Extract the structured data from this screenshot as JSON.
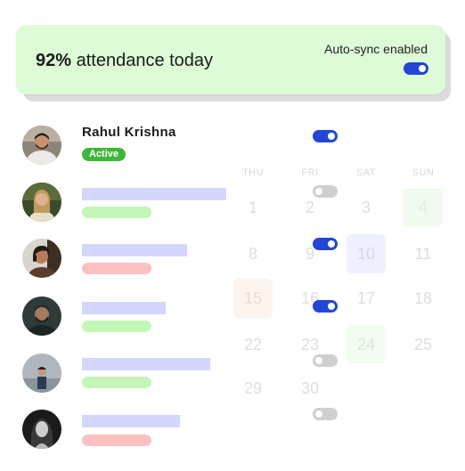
{
  "banner": {
    "percent": "92%",
    "title_rest": " attendance today",
    "sync_label": "Auto-sync enabled",
    "sync_on": true
  },
  "calendar": {
    "weekdays": [
      "THU",
      "FRI",
      "SAT",
      "SUN"
    ],
    "rows": [
      [
        "1",
        "2",
        "3",
        "4"
      ],
      [
        "8",
        "9",
        "10",
        "11"
      ],
      [
        "15",
        "16",
        "17",
        "18"
      ],
      [
        "22",
        "23",
        "24",
        "25"
      ],
      [
        "29",
        "30",
        "",
        ""
      ]
    ]
  },
  "students": [
    {
      "name": "Rahul Krishna",
      "status": "Active",
      "status_color": "green",
      "toggle_on": true,
      "avatar_icon": "person-avatar"
    },
    {
      "name": "",
      "status": "",
      "status_color": "green",
      "toggle_on": false,
      "avatar_icon": "person-avatar"
    },
    {
      "name": "",
      "status": "",
      "status_color": "red",
      "toggle_on": true,
      "avatar_icon": "person-avatar"
    },
    {
      "name": "",
      "status": "",
      "status_color": "green",
      "toggle_on": true,
      "avatar_icon": "person-avatar"
    },
    {
      "name": "",
      "status": "",
      "status_color": "green",
      "toggle_on": false,
      "avatar_icon": "person-avatar"
    },
    {
      "name": "",
      "status": "",
      "status_color": "red",
      "toggle_on": false,
      "avatar_icon": "person-avatar"
    }
  ],
  "colors": {
    "banner_bg": "#dcfbd6",
    "toggle_on": "#2346d6",
    "toggle_off": "#cfcfcf",
    "active_badge": "#3fb63a",
    "name_placeholder": "#d4d7fb",
    "status_green": "#c3f6b7",
    "status_red": "#fdc0c0"
  }
}
